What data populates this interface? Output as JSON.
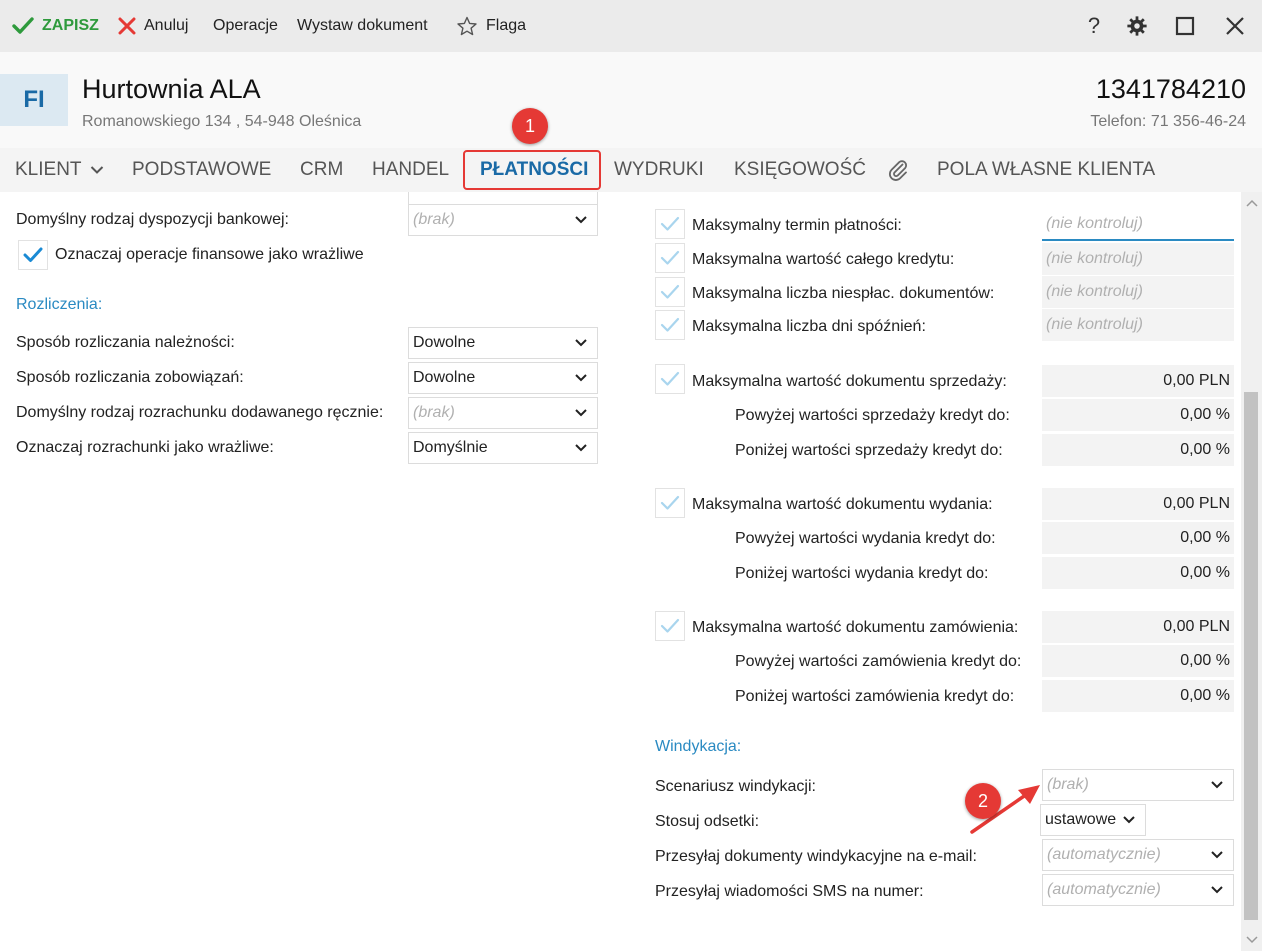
{
  "toolbar": {
    "save_label": "ZAPISZ",
    "cancel_label": "Anuluj",
    "operations_label": "Operacje",
    "issue_doc_label": "Wystaw dokument",
    "flag_label": "Flaga",
    "help_label": "?"
  },
  "header": {
    "avatar": "FI",
    "name": "Hurtownia ALA",
    "address": "Romanowskiego 134 , 54-948 Oleśnica",
    "nip": "1341784210",
    "phone": "Telefon: 71 356-46-24"
  },
  "tabs": {
    "klient": "KLIENT",
    "podstawowe": "PODSTAWOWE",
    "crm": "CRM",
    "handel": "HANDEL",
    "platnosci": "PŁATNOŚCI",
    "wydruki": "WYDRUKI",
    "ksiegowosc": "KSIĘGOWOŚĆ",
    "pola": "POLA WŁASNE KLIENTA"
  },
  "badges": {
    "one": "1",
    "two": "2"
  },
  "left": {
    "bank_label": "Domyślny rodzaj dyspozycji bankowej:",
    "bank_value": "(brak)",
    "sensitive_ops": "Oznaczaj operacje finansowe jako wrażliwe",
    "section": "Rozliczenia:",
    "rows": [
      {
        "label": "Sposób rozliczania należności:",
        "value": "Dowolne"
      },
      {
        "label": "Sposób rozliczania zobowiązań:",
        "value": "Dowolne"
      },
      {
        "label": "Domyślny rodzaj rozrachunku dodawanego ręcznie:",
        "value": "(brak)"
      },
      {
        "label": "Oznaczaj rozrachunki jako wrażliwe:",
        "value": "Domyślnie"
      }
    ]
  },
  "credit": {
    "placeholder": "(nie kontroluj)",
    "limits": [
      "Maksymalny termin płatności:",
      "Maksymalna wartość całego kredytu:",
      "Maksymalna liczba niespłac. dokumentów:",
      "Maksymalna liczba dni spóźnień:"
    ],
    "sales": {
      "label": "Maksymalna wartość dokumentu sprzedaży:",
      "value": "0,00 PLN",
      "above_label": "Powyżej wartości sprzedaży kredyt do:",
      "above_value": "0,00 %",
      "below_label": "Poniżej wartości sprzedaży kredyt do:",
      "below_value": "0,00 %"
    },
    "issue": {
      "label": "Maksymalna wartość dokumentu wydania:",
      "value": "0,00 PLN",
      "above_label": "Powyżej wartości wydania kredyt do:",
      "above_value": "0,00 %",
      "below_label": "Poniżej wartości wydania kredyt do:",
      "below_value": "0,00 %"
    },
    "order": {
      "label": "Maksymalna wartość dokumentu zamówienia:",
      "value": "0,00 PLN",
      "above_label": "Powyżej wartości zamówienia kredyt do:",
      "above_value": "0,00 %",
      "below_label": "Poniżej wartości zamówienia kredyt do:",
      "below_value": "0,00 %"
    }
  },
  "collection": {
    "section": "Windykacja:",
    "scenario_label": "Scenariusz windykacji:",
    "scenario_value": "(brak)",
    "interest_label": "Stosuj odsetki:",
    "interest_value": "ustawowe",
    "email_label": "Przesyłaj dokumenty windykacyjne na e-mail:",
    "email_value": "(automatycznie)",
    "sms_label": "Przesyłaj wiadomości SMS na numer:",
    "sms_value": "(automatycznie)"
  },
  "colors": {
    "accent": "#1a6aa6",
    "section": "#2a8ac2",
    "annotation": "#e53935",
    "save": "#2e9a3c"
  }
}
